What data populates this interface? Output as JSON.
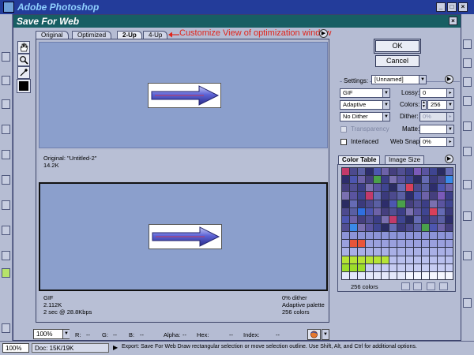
{
  "photoshop": {
    "app_title": "Adobe Photoshop",
    "zoom": "100%",
    "doc_info": "Doc: 15K/19K",
    "status_message": "Export: Save For Web   Draw rectangular selection or move selection outline.  Use Shift, Alt, and Ctrl for additional options."
  },
  "dialog": {
    "title": "Save For Web",
    "tabs": [
      {
        "label": "Original"
      },
      {
        "label": "Optimized"
      },
      {
        "label": "2-Up"
      },
      {
        "label": "4-Up"
      }
    ],
    "annotation": "Customize View of optimization window",
    "original_pane": {
      "line1": "Original: \"Untitled-2\"",
      "line2": "14.2K"
    },
    "optimized_pane": {
      "left1": "GIF",
      "left2": "2.112K",
      "left3": "2 sec @ 28.8Kbps",
      "right1": "0% dither",
      "right2": "Adaptive palette",
      "right3": "256 colors"
    },
    "bottom_bar": {
      "zoom": "100%",
      "r_label": "R:",
      "r_value": "--",
      "g_label": "G:",
      "g_value": "--",
      "b_label": "B:",
      "b_value": "--",
      "alpha_label": "Alpha:",
      "alpha_value": "--",
      "hex_label": "Hex:",
      "hex_value": "--",
      "index_label": "Index:",
      "index_value": "--"
    },
    "buttons": {
      "ok": "OK",
      "cancel": "Cancel"
    },
    "settings": {
      "label": "Settings:",
      "preset": "[Unnamed]",
      "format": "GIF",
      "lossy_label": "Lossy:",
      "lossy_value": "0",
      "palette": "Adaptive",
      "colors_label": "Colors:",
      "colors_value": "256",
      "dither_algo": "No Dither",
      "dither_label": "Dither:",
      "dither_value": "0%",
      "transparency_label": "Transparency",
      "matte_label": "Matte:",
      "interlaced_label": "Interlaced",
      "websnap_label": "Web Snap:",
      "websnap_value": "0%"
    },
    "color_table": {
      "tab1": "Color Table",
      "tab2": "Image Size",
      "count": "256 colors",
      "colors": [
        "#3b3a7c",
        "#4c4a8e",
        "#5a5fa3",
        "#2d2d6b",
        "#4d56b0",
        "#6d62a8",
        "#453f7e",
        "#514f93",
        "#3c3e86",
        "#7a70b0",
        "#5a54a0",
        "#3f4591",
        "#2a2c62",
        "#656bb4"
      ]
    }
  }
}
